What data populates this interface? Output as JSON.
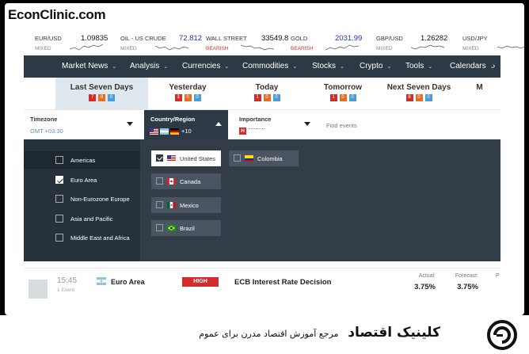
{
  "brand": "EconClinic.com",
  "ticker": [
    {
      "name": "EUR/USD",
      "value": "1.09835",
      "sub": "MIXED",
      "sub_bear": false,
      "value_pos": false
    },
    {
      "name": "OIL - US CRUDE",
      "value": "72.812",
      "sub": "MIXED",
      "sub_bear": false,
      "value_pos": true
    },
    {
      "name": "WALL STREET",
      "value": "33549.8",
      "sub": "BEARISH",
      "sub_bear": true,
      "value_pos": false
    },
    {
      "name": "GOLD",
      "value": "2031.99",
      "sub": "BEARISH",
      "sub_bear": true,
      "value_pos": true
    },
    {
      "name": "GBP/USD",
      "value": "1.26282",
      "sub": "MIXED",
      "sub_bear": false,
      "value_pos": false
    },
    {
      "name": "USD/JPY",
      "value": "",
      "sub": "MIXED",
      "sub_bear": false,
      "value_pos": false
    }
  ],
  "nav": [
    "Market News",
    "Analysis",
    "Currencies",
    "Commodities",
    "Stocks",
    "Crypto",
    "Tools",
    "Calendars"
  ],
  "days": [
    {
      "label": "Last Seven Days",
      "high": "7",
      "med": "8",
      "low": "0",
      "active": true
    },
    {
      "label": "Yesterday",
      "high": "3",
      "med": "0",
      "low": "0",
      "active": false
    },
    {
      "label": "Today",
      "high": "1",
      "med": "0",
      "low": "0",
      "active": false
    },
    {
      "label": "Tomorrow",
      "high": "1",
      "med": "0",
      "low": "0",
      "active": false
    },
    {
      "label": "Next Seven Days",
      "high": "8",
      "med": "0",
      "low": "0",
      "active": false
    },
    {
      "label": "M",
      "high": "",
      "med": "",
      "low": "",
      "active": false
    }
  ],
  "filters": {
    "timezone_label": "Timezone",
    "timezone_value": "GMT +03:30",
    "country_label": "Country/Region",
    "country_more": "+10",
    "importance_label": "Importance",
    "importance_high": "H",
    "find_placeholder": "Find events"
  },
  "regions": [
    {
      "label": "Americas",
      "checked": false
    },
    {
      "label": "Euro Area",
      "checked": true
    },
    {
      "label": "Non-Eurozone Europe",
      "checked": false
    },
    {
      "label": "Asia and Pacific",
      "checked": false
    },
    {
      "label": "Middle East and Africa",
      "checked": false
    }
  ],
  "countries": [
    {
      "label": "United States",
      "flag": "us",
      "selected": true
    },
    {
      "label": "Canada",
      "flag": "ca",
      "selected": false
    },
    {
      "label": "Mexico",
      "flag": "mx",
      "selected": false
    },
    {
      "label": "Brazil",
      "flag": "br",
      "selected": false
    },
    {
      "label": "Colombia",
      "flag": "co",
      "selected": false
    }
  ],
  "event": {
    "time": "15:45",
    "sub": "1 Event",
    "zone": "Euro Area",
    "importance": "HIGH",
    "title": "ECB Interest Rate Decision",
    "actual_label": "Actual:",
    "actual": "3.75%",
    "forecast_label": "Forecast:",
    "forecast": "3.75%",
    "previous_label": "P"
  },
  "footer": {
    "brand_fa": "کلینیک اقتصاد",
    "tagline_fa": "مرجع آموزش اقتصاد مدرن برای عموم"
  },
  "colors": {
    "nav_bg": "#2d3945",
    "high": "#d32b2b",
    "med": "#e86c23",
    "low": "#4a9bd8"
  }
}
